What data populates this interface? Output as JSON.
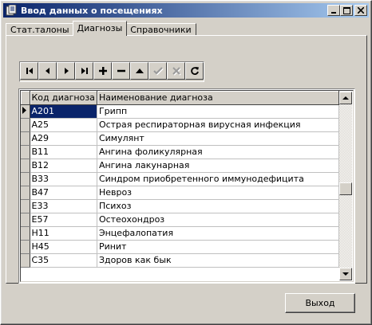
{
  "window": {
    "title": "Ввод данных о посещениях",
    "minimize_glyph": "_",
    "maximize_glyph": "□",
    "close_glyph": "×"
  },
  "tabs": [
    {
      "label": "Стат.талоны",
      "active": false
    },
    {
      "label": "Диагнозы",
      "active": true
    },
    {
      "label": "Справочники",
      "active": false
    }
  ],
  "navigator": {
    "buttons": [
      {
        "icon": "first-record-icon",
        "enabled": true
      },
      {
        "icon": "prior-record-icon",
        "enabled": true
      },
      {
        "icon": "next-record-icon",
        "enabled": true
      },
      {
        "icon": "last-record-icon",
        "enabled": true
      },
      {
        "icon": "insert-record-icon",
        "enabled": true
      },
      {
        "icon": "delete-record-icon",
        "enabled": true
      },
      {
        "icon": "edit-record-icon",
        "enabled": true
      },
      {
        "icon": "post-record-icon",
        "enabled": false
      },
      {
        "icon": "cancel-record-icon",
        "enabled": false
      },
      {
        "icon": "refresh-icon",
        "enabled": true
      }
    ]
  },
  "grid": {
    "columns": [
      "Код диагноза",
      "Наименование диагноза"
    ],
    "rows": [
      {
        "code": "A201",
        "name": "Грипп",
        "selected": true
      },
      {
        "code": "A25",
        "name": "Острая респираторная вирусная инфекция"
      },
      {
        "code": "A29",
        "name": "Симулянт"
      },
      {
        "code": "B11",
        "name": "Ангина фоликулярная"
      },
      {
        "code": "B12",
        "name": "Ангина лакунарная"
      },
      {
        "code": "B33",
        "name": "Синдром приобретенного иммунодефицита"
      },
      {
        "code": "B47",
        "name": "Невроз"
      },
      {
        "code": "E33",
        "name": "Психоз"
      },
      {
        "code": "E57",
        "name": "Остеохондроз"
      },
      {
        "code": "H11",
        "name": "Энцефалопатия"
      },
      {
        "code": "H45",
        "name": "Ринит"
      },
      {
        "code": "C35",
        "name": "Здоров как бык"
      }
    ]
  },
  "exit_button": {
    "label": "Выход"
  },
  "colors": {
    "titlebar_start": "#0a246a",
    "titlebar_end": "#a6caf0",
    "selection": "#0a246a",
    "face": "#d4d0c8"
  }
}
